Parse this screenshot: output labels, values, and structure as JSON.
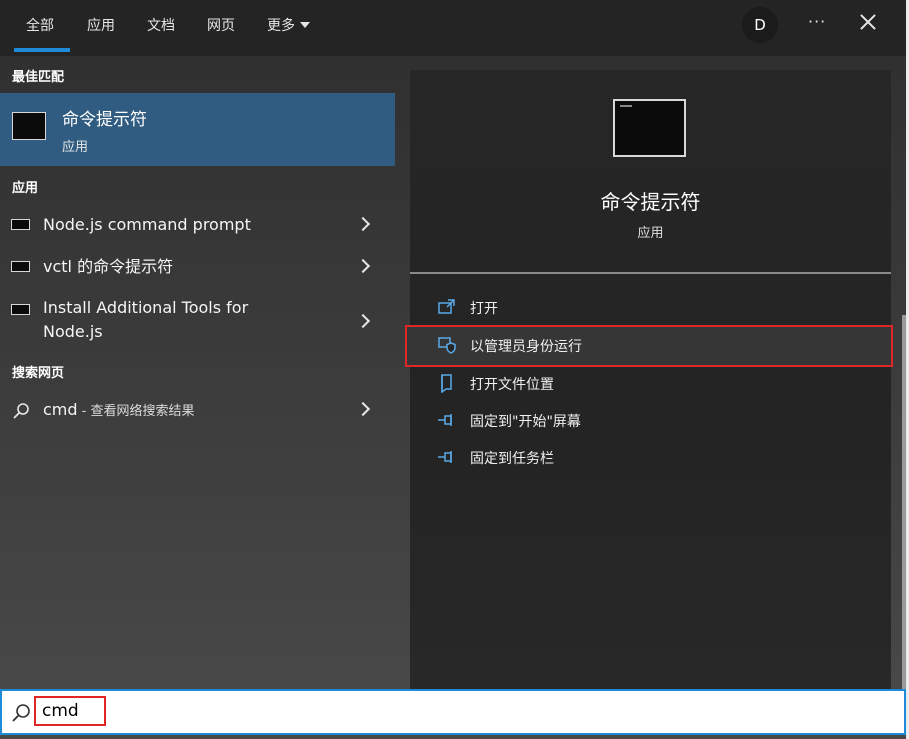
{
  "tabs": [
    {
      "label": "全部",
      "active": true
    },
    {
      "label": "应用"
    },
    {
      "label": "文档"
    },
    {
      "label": "网页"
    },
    {
      "label": "更多"
    }
  ],
  "header": {
    "avatar": "D",
    "more": "···"
  },
  "left": {
    "best_match_title": "最佳匹配",
    "best_match": {
      "title": "命令提示符",
      "subtitle": "应用"
    },
    "apps_title": "应用",
    "apps": [
      {
        "label": "Node.js command prompt"
      },
      {
        "label": "vctl 的命令提示符"
      },
      {
        "label_line1": "Install Additional Tools for",
        "label_line2": "Node.js"
      }
    ],
    "web_title": "搜索网页",
    "web_query": "cmd",
    "web_suffix": " - 查看网络搜索结果"
  },
  "right": {
    "title": "命令提示符",
    "subtitle": "应用",
    "actions": [
      {
        "label": "打开",
        "icon": "open-icon"
      },
      {
        "label": "以管理员身份运行",
        "icon": "shield-icon"
      },
      {
        "label": "打开文件位置",
        "icon": "file-location-icon"
      },
      {
        "label": "固定到\"开始\"屏幕",
        "icon": "pin-icon"
      },
      {
        "label": "固定到任务栏",
        "icon": "pin-icon"
      }
    ]
  },
  "search": {
    "value": "cmd"
  },
  "colors": {
    "accent": "#1f8ad8",
    "selection": "#305c82",
    "highlight_border": "#e02626"
  }
}
